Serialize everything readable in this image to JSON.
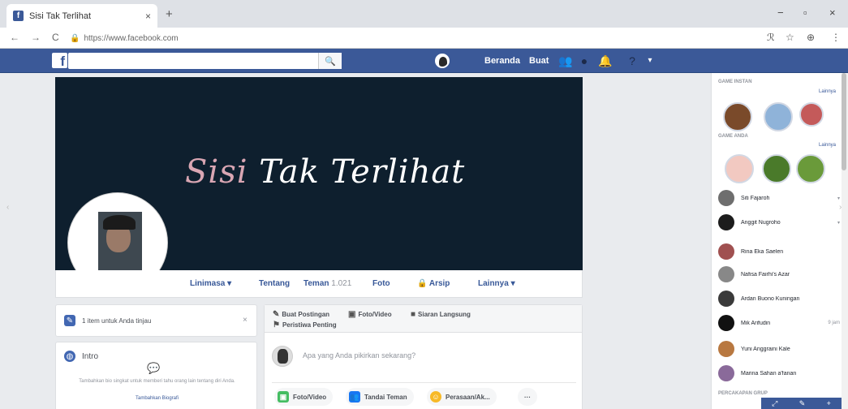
{
  "browser": {
    "tab_title": "Sisi Tak Terlihat",
    "tab_close": "×",
    "new_tab": "+",
    "url": "https://www.facebook.com",
    "back": "←",
    "forward": "→",
    "reload": "C",
    "minimize": "−",
    "maximize": "▫",
    "close": "×"
  },
  "fb": {
    "logo": "f",
    "search_placeholder": "",
    "nav": {
      "home": "Beranda",
      "create": "Buat"
    }
  },
  "profile": {
    "cover_text_pink": "Sisi ",
    "cover_text_white": "Tak Terlihat",
    "tabs": [
      {
        "label": "Linimasa ▾"
      },
      {
        "label": "Tentang"
      },
      {
        "label": "Teman",
        "count": "1.021"
      },
      {
        "label": "Foto"
      },
      {
        "label": "🔒 Arsip"
      },
      {
        "label": "Lainnya ▾"
      }
    ]
  },
  "left": {
    "card1_text": "1 item untuk Anda tinjau",
    "card1_close": "×",
    "intro_title": "Intro",
    "intro_desc": "Tambahkan bio singkat untuk memberi tahu orang lain tentang diri Anda.",
    "intro_link": "Tambahkan Biografi"
  },
  "composer": {
    "tabs": [
      {
        "label": "Buat Postingan"
      },
      {
        "label": "Foto/Video"
      },
      {
        "label": "Siaran Langsung"
      },
      {
        "label": "Peristiwa Penting"
      }
    ],
    "placeholder": "Apa yang Anda pikirkan sekarang?",
    "buttons": [
      {
        "label": "Foto/Video"
      },
      {
        "label": "Tandai Teman"
      },
      {
        "label": "Perasaan/Ak..."
      },
      {
        "label": "···"
      }
    ]
  },
  "chat": {
    "section1": "GAME INSTAN",
    "section1_link": "Lainnya",
    "section2": "GAME ANDA",
    "section2_link": "Lainnya",
    "contacts": [
      {
        "name": "Siti Fajaroh",
        "meta": "▾"
      },
      {
        "name": "Anggit Nugroho",
        "meta": "▾"
      },
      {
        "name": "Rina Eka Saelen",
        "meta": ""
      },
      {
        "name": "Nafisa Fairhi's Azar",
        "meta": ""
      },
      {
        "name": "Ardan Buono Kuningan",
        "meta": ""
      },
      {
        "name": "Mik Arifudin",
        "meta": "9 jam"
      },
      {
        "name": "Yuni Anggraini Kale",
        "meta": ""
      },
      {
        "name": "Marina Sahan a'fanan",
        "meta": ""
      }
    ],
    "section3": "PERCAKAPAN GRUP"
  }
}
